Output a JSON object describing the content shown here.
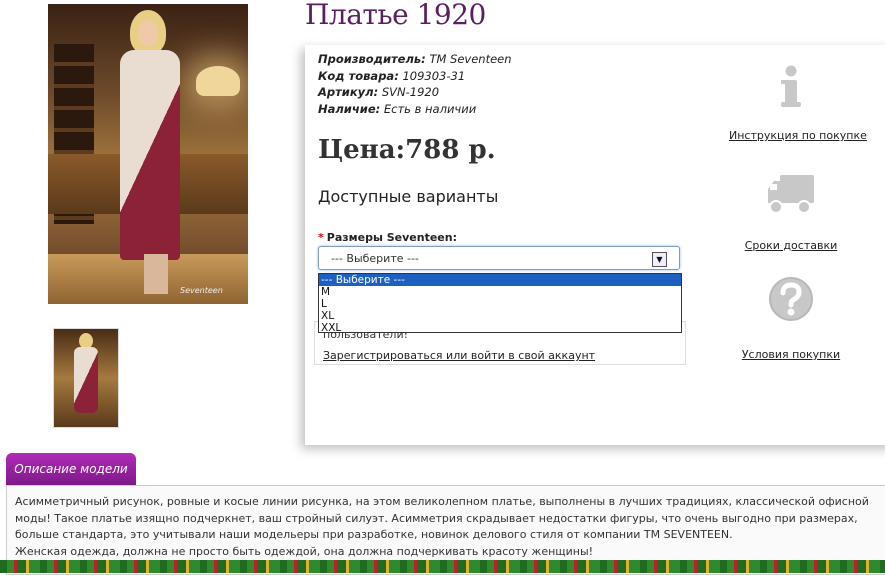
{
  "product": {
    "title": "Платье 1920",
    "manufacturer_label": "Производитель:",
    "manufacturer": "TM Seventeen",
    "code_label": "Код товара:",
    "code": "109303-31",
    "article_label": "Артикул:",
    "article": "SVN-1920",
    "availability_label": "Наличие:",
    "availability": "Есть в наличии",
    "price": "Цена:788 р.",
    "variants_heading": "Доступные варианты",
    "size_required_mark": "*",
    "size_label": "Размеры Seventeen:",
    "size_selected": "--- Выберите ---",
    "size_options": [
      "--- Выберите ---",
      "M",
      "L",
      "XL",
      "XXL"
    ]
  },
  "login_box": {
    "text": "пользователи!",
    "link": "Зарегистрироваться или войти в свой аккаунт"
  },
  "sidebar": {
    "items": [
      {
        "icon": "info-icon",
        "label": "Инструкция по покупке"
      },
      {
        "icon": "truck-icon",
        "label": "Сроки доставки"
      },
      {
        "icon": "question-icon",
        "label": "Условия покупки"
      }
    ]
  },
  "tabs": {
    "description_label": "Описание модели"
  },
  "description": {
    "line1": "Асимметричный рисунок, ровные и косые линии рисунка, на этом великолепном платье, выполнены в лучших традициях, классической офисной моды! Такое платье изящно подчеркнет, ваш стройный силуэт. Асимметрия скрадывает недостатки фигуры, что очень выгодно при размерах, больше стандарта, это учитывали наши модельеры при разработке, новинок делового стиля от компании TM SEVENTEEN.",
    "line2": "Женская одежда, должна не просто быть одеждой, она должна подчеркивать красоту женщины!"
  },
  "colors": {
    "title": "#5a1f5e",
    "tab_accent": "#9c22a6",
    "selection": "#1e5fc2",
    "icon_gray": "#c8c8c8"
  }
}
